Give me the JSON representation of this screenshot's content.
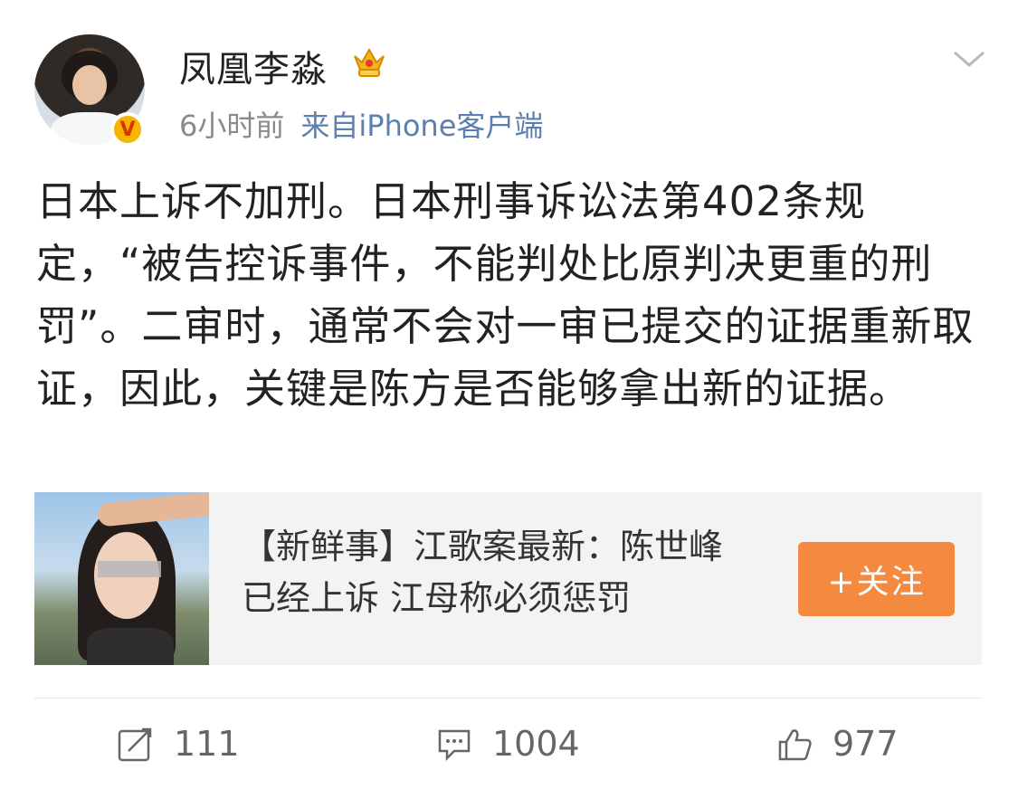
{
  "post": {
    "username": "凤凰李淼",
    "time": "6小时前",
    "source": "来自iPhone客户端",
    "content": "日本上诉不加刑。日本刑事诉讼法第402条规定，“被告控诉事件，不能判处比原判决更重的刑罚”。二审时，通常不会对一审已提交的证据重新取证，因此，关键是陈方是否能够拿出新的证据。",
    "verified_badge": "V"
  },
  "card": {
    "title": "【新鲜事】江歌案最新：陈世峰已经上诉 江母称必须惩罚",
    "follow_label": "+关注"
  },
  "actions": {
    "repost_count": "111",
    "comment_count": "1004",
    "like_count": "977"
  },
  "icons": {
    "repost": "repost-icon",
    "comment": "comment-icon",
    "like": "like-icon",
    "crown": "crown-icon",
    "chevron": "chevron-down-icon"
  },
  "colors": {
    "follow_button": "#f38a3f",
    "source_link": "#5b7fb0",
    "muted_text": "#8a8a8a"
  }
}
